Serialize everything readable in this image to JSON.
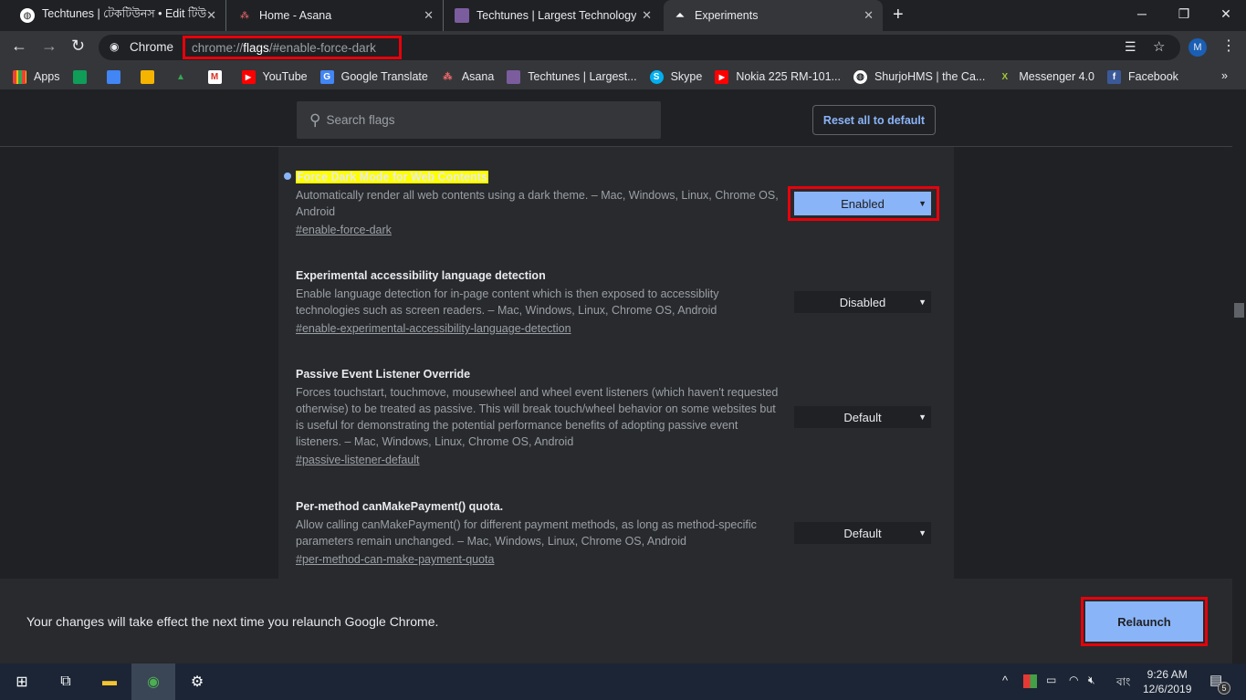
{
  "tabs": [
    {
      "title": "Techtunes | টেকটিউনস • Edit টিউ",
      "icon": "globe-icon"
    },
    {
      "title": "Home - Asana",
      "icon": "asana-icon"
    },
    {
      "title": "Techtunes | Largest Technology S",
      "icon": "techtunes-icon"
    },
    {
      "title": "Experiments",
      "icon": "flask-icon",
      "active": true
    }
  ],
  "omnibox": {
    "site_label": "Chrome",
    "url_prefix": "chrome://",
    "url_bold": "flags",
    "url_suffix": "/#enable-force-dark"
  },
  "profile_initial": "M",
  "bookmarks": [
    "Apps",
    "",
    "",
    "",
    "",
    "",
    "YouTube",
    "Google Translate",
    "Asana",
    "Techtunes | Largest...",
    "Skype",
    "Nokia 225 RM-101...",
    "ShurjoHMS | the Ca...",
    "Messenger 4.0",
    "Facebook"
  ],
  "search": {
    "placeholder": "Search flags"
  },
  "reset_label": "Reset all to default",
  "flags": [
    {
      "title": "Force Dark Mode for Web Contents",
      "desc": "Automatically render all web contents using a dark theme. – Mac, Windows, Linux, Chrome OS, Android",
      "link": "#enable-force-dark",
      "value": "Enabled"
    },
    {
      "title": "Experimental accessibility language detection",
      "desc": "Enable language detection for in-page content which is then exposed to accessiblity technologies such as screen readers. – Mac, Windows, Linux, Chrome OS, Android",
      "link": "#enable-experimental-accessibility-language-detection",
      "value": "Disabled"
    },
    {
      "title": "Passive Event Listener Override",
      "desc": "Forces touchstart, touchmove, mousewheel and wheel event listeners (which haven't requested otherwise) to be treated as passive. This will break touch/wheel behavior on some websites but is useful for demonstrating the potential performance benefits of adopting passive event listeners. – Mac, Windows, Linux, Chrome OS, Android",
      "link": "#passive-listener-default",
      "value": "Default"
    },
    {
      "title": "Per-method canMakePayment() quota.",
      "desc": "Allow calling canMakePayment() for different payment methods, as long as method-specific parameters remain unchanged. – Mac, Windows, Linux, Chrome OS, Android",
      "link": "#per-method-can-make-payment-quota",
      "value": "Default"
    }
  ],
  "bottom": {
    "message": "Your changes will take effect the next time you relaunch Google Chrome.",
    "relaunch": "Relaunch"
  },
  "taskbar": {
    "time": "9:26 AM",
    "date": "12/6/2019",
    "lang": "বাং",
    "notifications": "5"
  }
}
